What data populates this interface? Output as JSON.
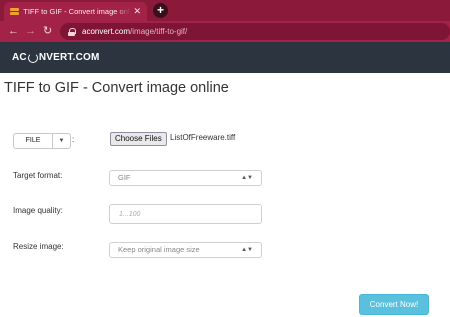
{
  "browser": {
    "tab_title": "TIFF to GIF - Convert image online",
    "tab_close": "✕",
    "new_tab": "+",
    "url_host": "aconvert.com",
    "url_path": "/image/tiff-to-gif/"
  },
  "site": {
    "logo_prefix": "AC",
    "logo_suffix": "NVERT.COM"
  },
  "page": {
    "title": "TIFF to GIF - Convert image online"
  },
  "form": {
    "file_source_label": "FILE",
    "file_colon": ":",
    "choose_files_label": "Choose Files",
    "chosen_file": "ListOfFreeware.tiff",
    "target_format_label": "Target format:",
    "target_format_value": "GIF",
    "image_quality_label": "Image quality:",
    "image_quality_placeholder": "1...100",
    "resize_label": "Resize image:",
    "resize_value": "Keep original image size",
    "convert_label": "Convert Now!"
  },
  "colors": {
    "browser_accent": "#a32248",
    "header_bg": "#2c3440",
    "convert_button": "#5bc0de"
  }
}
